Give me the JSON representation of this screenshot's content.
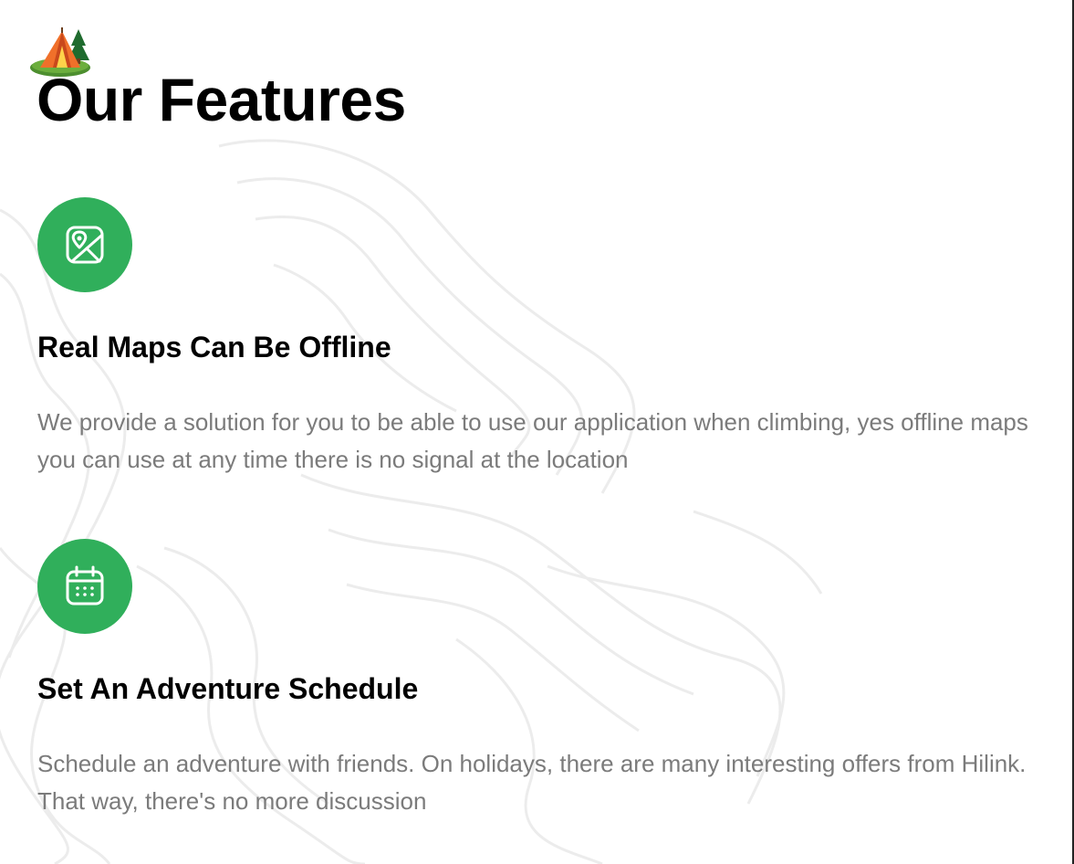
{
  "section": {
    "title": "Our Features"
  },
  "features": [
    {
      "icon": "map-pin-icon",
      "title": "Real Maps Can Be Offline",
      "description": "We provide a solution for you to be able to use our application when climbing, yes offline maps you can use at any time there is no signal at the location"
    },
    {
      "icon": "calendar-icon",
      "title": "Set An Adventure Schedule",
      "description": "Schedule an adventure with friends. On holidays, there are many interesting offers from Hilink. That way, there's no more discussion"
    }
  ],
  "colors": {
    "accent": "#30AF5B",
    "heading": "#000000",
    "body_text": "#7B7B7B",
    "background": "#FFFFFF"
  }
}
